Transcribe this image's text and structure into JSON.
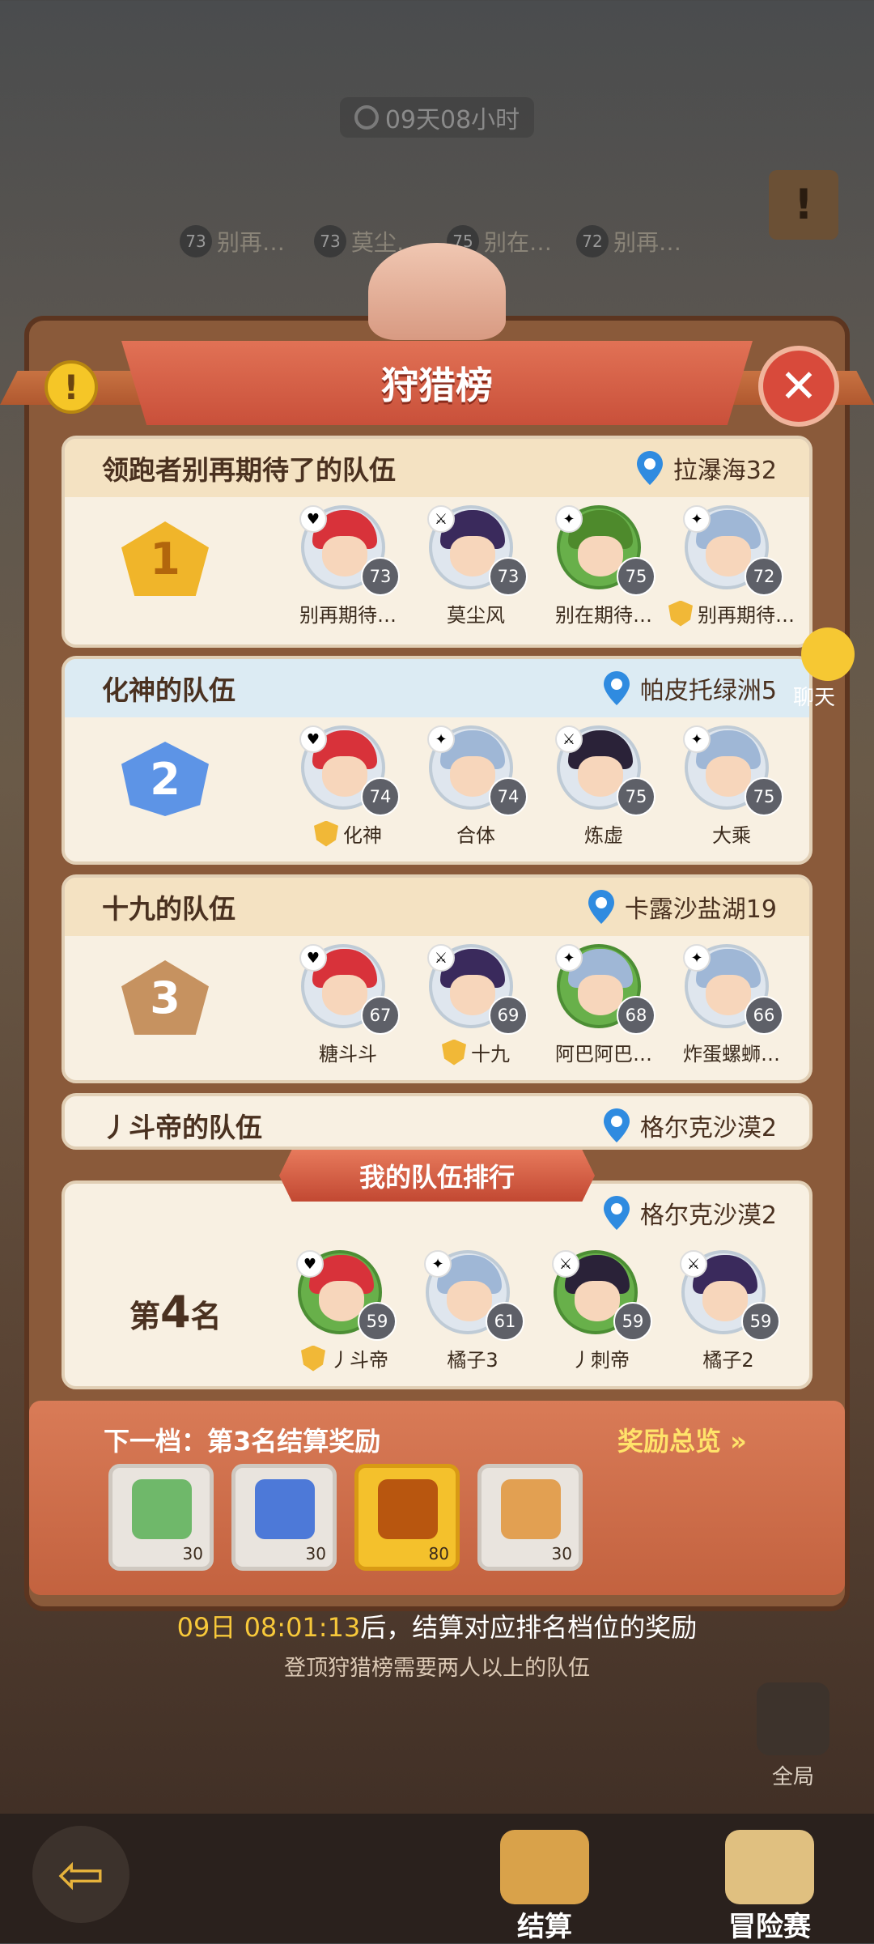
{
  "timer": "09天08小时",
  "world_tags": [
    {
      "lv": "73",
      "name": "别再…"
    },
    {
      "lv": "73",
      "name": "莫尘…"
    },
    {
      "lv": "75",
      "name": "别在…"
    },
    {
      "lv": "72",
      "name": "别再…"
    }
  ],
  "panel": {
    "title": "狩猎榜"
  },
  "teams": [
    {
      "rank": "1",
      "name": "领跑者别再期待了的队伍",
      "location": "拉瀑海32",
      "members": [
        {
          "name": "别再期待…",
          "level": "73",
          "cls": "♥",
          "hair": "#d8323a",
          "shield": false,
          "green": false
        },
        {
          "name": "莫尘风",
          "level": "73",
          "cls": "⚔",
          "hair": "#3a2a5c",
          "shield": false,
          "green": false
        },
        {
          "name": "别在期待…",
          "level": "75",
          "cls": "✦",
          "hair": "#4e8a2c",
          "shield": false,
          "green": true
        },
        {
          "name": "别再期待…",
          "level": "72",
          "cls": "✦",
          "hair": "#9fb7d6",
          "shield": true,
          "green": false
        }
      ]
    },
    {
      "rank": "2",
      "name": "化神的队伍",
      "location": "帕皮托绿洲5",
      "members": [
        {
          "name": "化神",
          "level": "74",
          "cls": "♥",
          "hair": "#d8323a",
          "shield": true,
          "green": false
        },
        {
          "name": "合体",
          "level": "74",
          "cls": "✦",
          "hair": "#9fb7d6",
          "shield": false,
          "green": false
        },
        {
          "name": "炼虚",
          "level": "75",
          "cls": "⚔",
          "hair": "#2a2238",
          "shield": false,
          "green": false
        },
        {
          "name": "大乘",
          "level": "75",
          "cls": "✦",
          "hair": "#9fb7d6",
          "shield": false,
          "green": false
        }
      ]
    },
    {
      "rank": "3",
      "name": "十九的队伍",
      "location": "卡露沙盐湖19",
      "members": [
        {
          "name": "糖斗斗",
          "level": "67",
          "cls": "♥",
          "hair": "#d8323a",
          "shield": false,
          "green": false
        },
        {
          "name": "十九",
          "level": "69",
          "cls": "⚔",
          "hair": "#3a2a5c",
          "shield": true,
          "green": false
        },
        {
          "name": "阿巴阿巴…",
          "level": "68",
          "cls": "✦",
          "hair": "#9fb7d6",
          "shield": false,
          "green": true
        },
        {
          "name": "炸蛋螺蛳…",
          "level": "66",
          "cls": "✦",
          "hair": "#9fb7d6",
          "shield": false,
          "green": false
        }
      ]
    }
  ],
  "fourth_team": {
    "name": "丿斗帝的队伍",
    "location": "格尔克沙漠2"
  },
  "my_team": {
    "banner": "我的队伍排行",
    "rank_prefix": "第",
    "rank_num": "4",
    "rank_suffix": "名",
    "location": "格尔克沙漠2",
    "members": [
      {
        "name": "丿斗帝",
        "level": "59",
        "cls": "♥",
        "hair": "#d8323a",
        "shield": true,
        "green": true
      },
      {
        "name": "橘子3",
        "level": "61",
        "cls": "✦",
        "hair": "#9fb7d6",
        "shield": false,
        "green": false
      },
      {
        "name": "丿刺帝",
        "level": "59",
        "cls": "⚔",
        "hair": "#2a2238",
        "shield": false,
        "green": true
      },
      {
        "name": "橘子2",
        "level": "59",
        "cls": "⚔",
        "hair": "#3a2a5c",
        "shield": false,
        "green": false
      }
    ]
  },
  "reward": {
    "title": "下一档：第3名结算奖励",
    "overview": "奖励总览",
    "items": [
      {
        "icon": "green-ticket-icon",
        "count": "30",
        "color": "#6fb86a",
        "gold": false
      },
      {
        "icon": "blue-crystal-icon",
        "count": "30",
        "color": "#4d79d8",
        "gold": false
      },
      {
        "icon": "golden-orb-icon",
        "count": "80",
        "color": "#b8560f",
        "gold": true
      },
      {
        "icon": "food-plate-icon",
        "count": "30",
        "color": "#e2a052",
        "gold": false
      }
    ]
  },
  "countdown_time": "09日 08:01:13",
  "countdown_text": "后，结算对应排名档位的奖励",
  "hint": "登顶狩猎榜需要两人以上的队伍",
  "chat_label": "聊天",
  "global_label": "全局",
  "nav": {
    "settle": "结算",
    "adventure": "冒险赛"
  },
  "colors": {
    "accent": "#d84a3b",
    "gold": "#f7c83a",
    "card": "#f8f0e2"
  }
}
